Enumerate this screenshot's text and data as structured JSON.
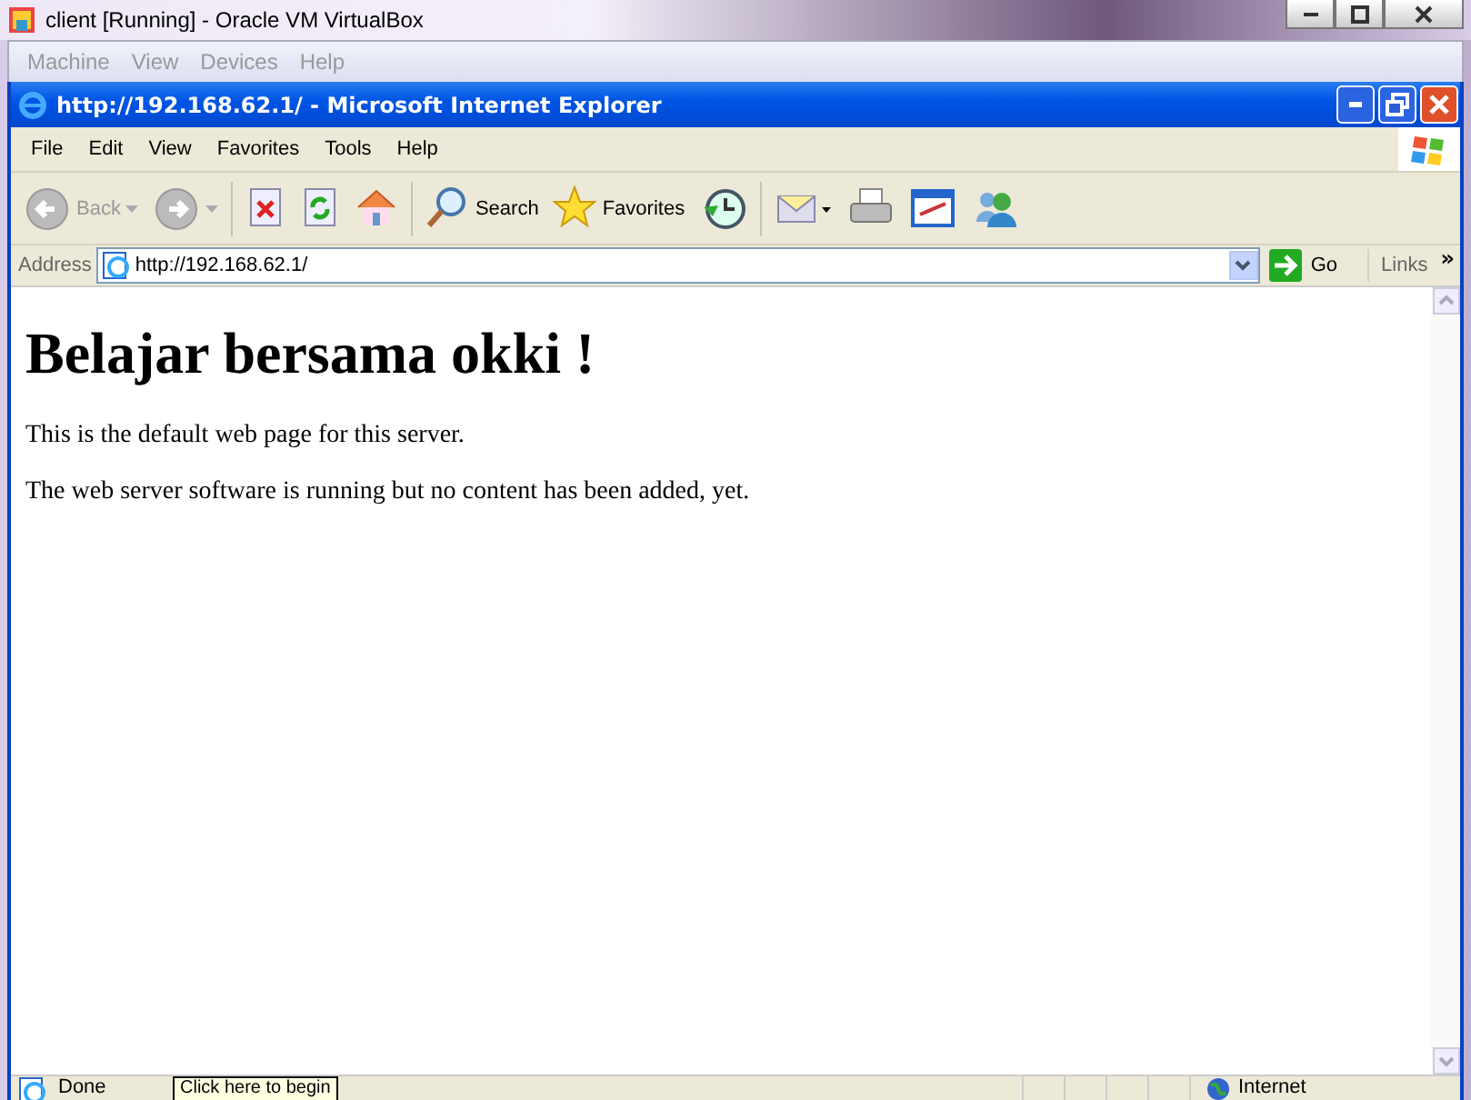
{
  "host_window": {
    "title": "client [Running] - Oracle VM VirtualBox",
    "menu": [
      {
        "label": "Machine",
        "disabled": true
      },
      {
        "label": "View",
        "disabled": true
      },
      {
        "label": "Devices",
        "disabled": true
      },
      {
        "label": "Help",
        "disabled": true
      }
    ]
  },
  "browser": {
    "title": "http://192.168.62.1/ - Microsoft Internet Explorer",
    "menu": [
      "File",
      "Edit",
      "View",
      "Favorites",
      "Tools",
      "Help"
    ],
    "toolbar": [
      {
        "kind": "back",
        "label": "Back",
        "disabled": true
      },
      {
        "kind": "forward",
        "disabled": true
      },
      {
        "kind": "stop"
      },
      {
        "kind": "refresh"
      },
      {
        "kind": "home"
      },
      {
        "kind": "search",
        "label": "Search"
      },
      {
        "kind": "favorites",
        "label": "Favorites"
      },
      {
        "kind": "history"
      },
      {
        "kind": "mail"
      },
      {
        "kind": "print"
      },
      {
        "kind": "edit"
      },
      {
        "kind": "messenger"
      }
    ],
    "address": {
      "label": "Address",
      "value": "http://192.168.62.1/",
      "go": "Go",
      "links": "Links",
      "more": "»"
    },
    "page": {
      "heading": "Belajar bersama okki !",
      "paragraphs": [
        "This is the default web page for this server.",
        "The web server software is running but no content has been added, yet."
      ]
    },
    "status_bar": {
      "status": "Done",
      "tooltip": "Click here to begin",
      "zone": "Internet"
    }
  }
}
